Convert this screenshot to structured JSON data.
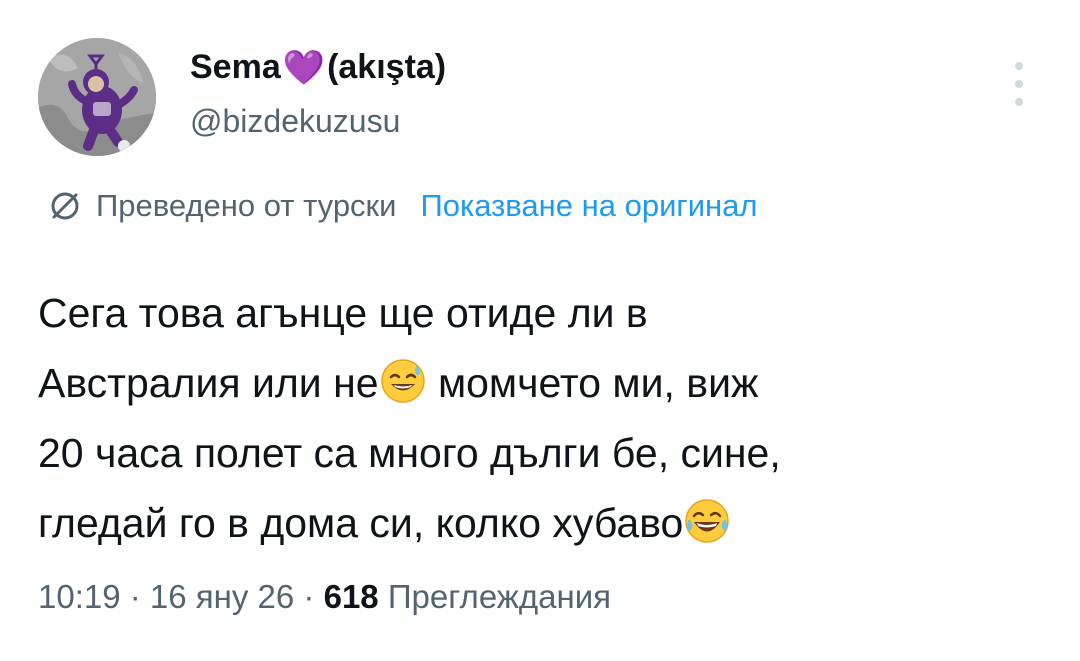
{
  "author": {
    "name_before": "Sema",
    "heart": "💜",
    "name_after": "(akışta)",
    "handle": "@bizdekuzusu",
    "avatar_icon": "teletubby-avatar"
  },
  "translation": {
    "icon": "translate-globe-icon",
    "translated_label": "Преведено от турски",
    "show_original_label": "Показване на оригинал"
  },
  "tweet": {
    "line1": "Сега това агънце ще отиде ли в",
    "line2_a": "Австралия или не",
    "line2_emoji": "sweat-smile-emoji",
    "line2_b": " момчето ми, виж",
    "line3": "20 часа полет са много дълги бе, сине,",
    "line4_a": "гледай го в дома си, колко хубаво",
    "line4_emoji": "tears-of-joy-emoji"
  },
  "meta": {
    "time": "10:19",
    "sep1": " · ",
    "date": "16 яну 26",
    "sep2": " · ",
    "views_count": "618",
    "views_label": " Преглеждания"
  },
  "colors": {
    "text": "#0f1419",
    "secondary": "#536471",
    "link": "#1d9bf0",
    "heart": "#a94ee6"
  }
}
